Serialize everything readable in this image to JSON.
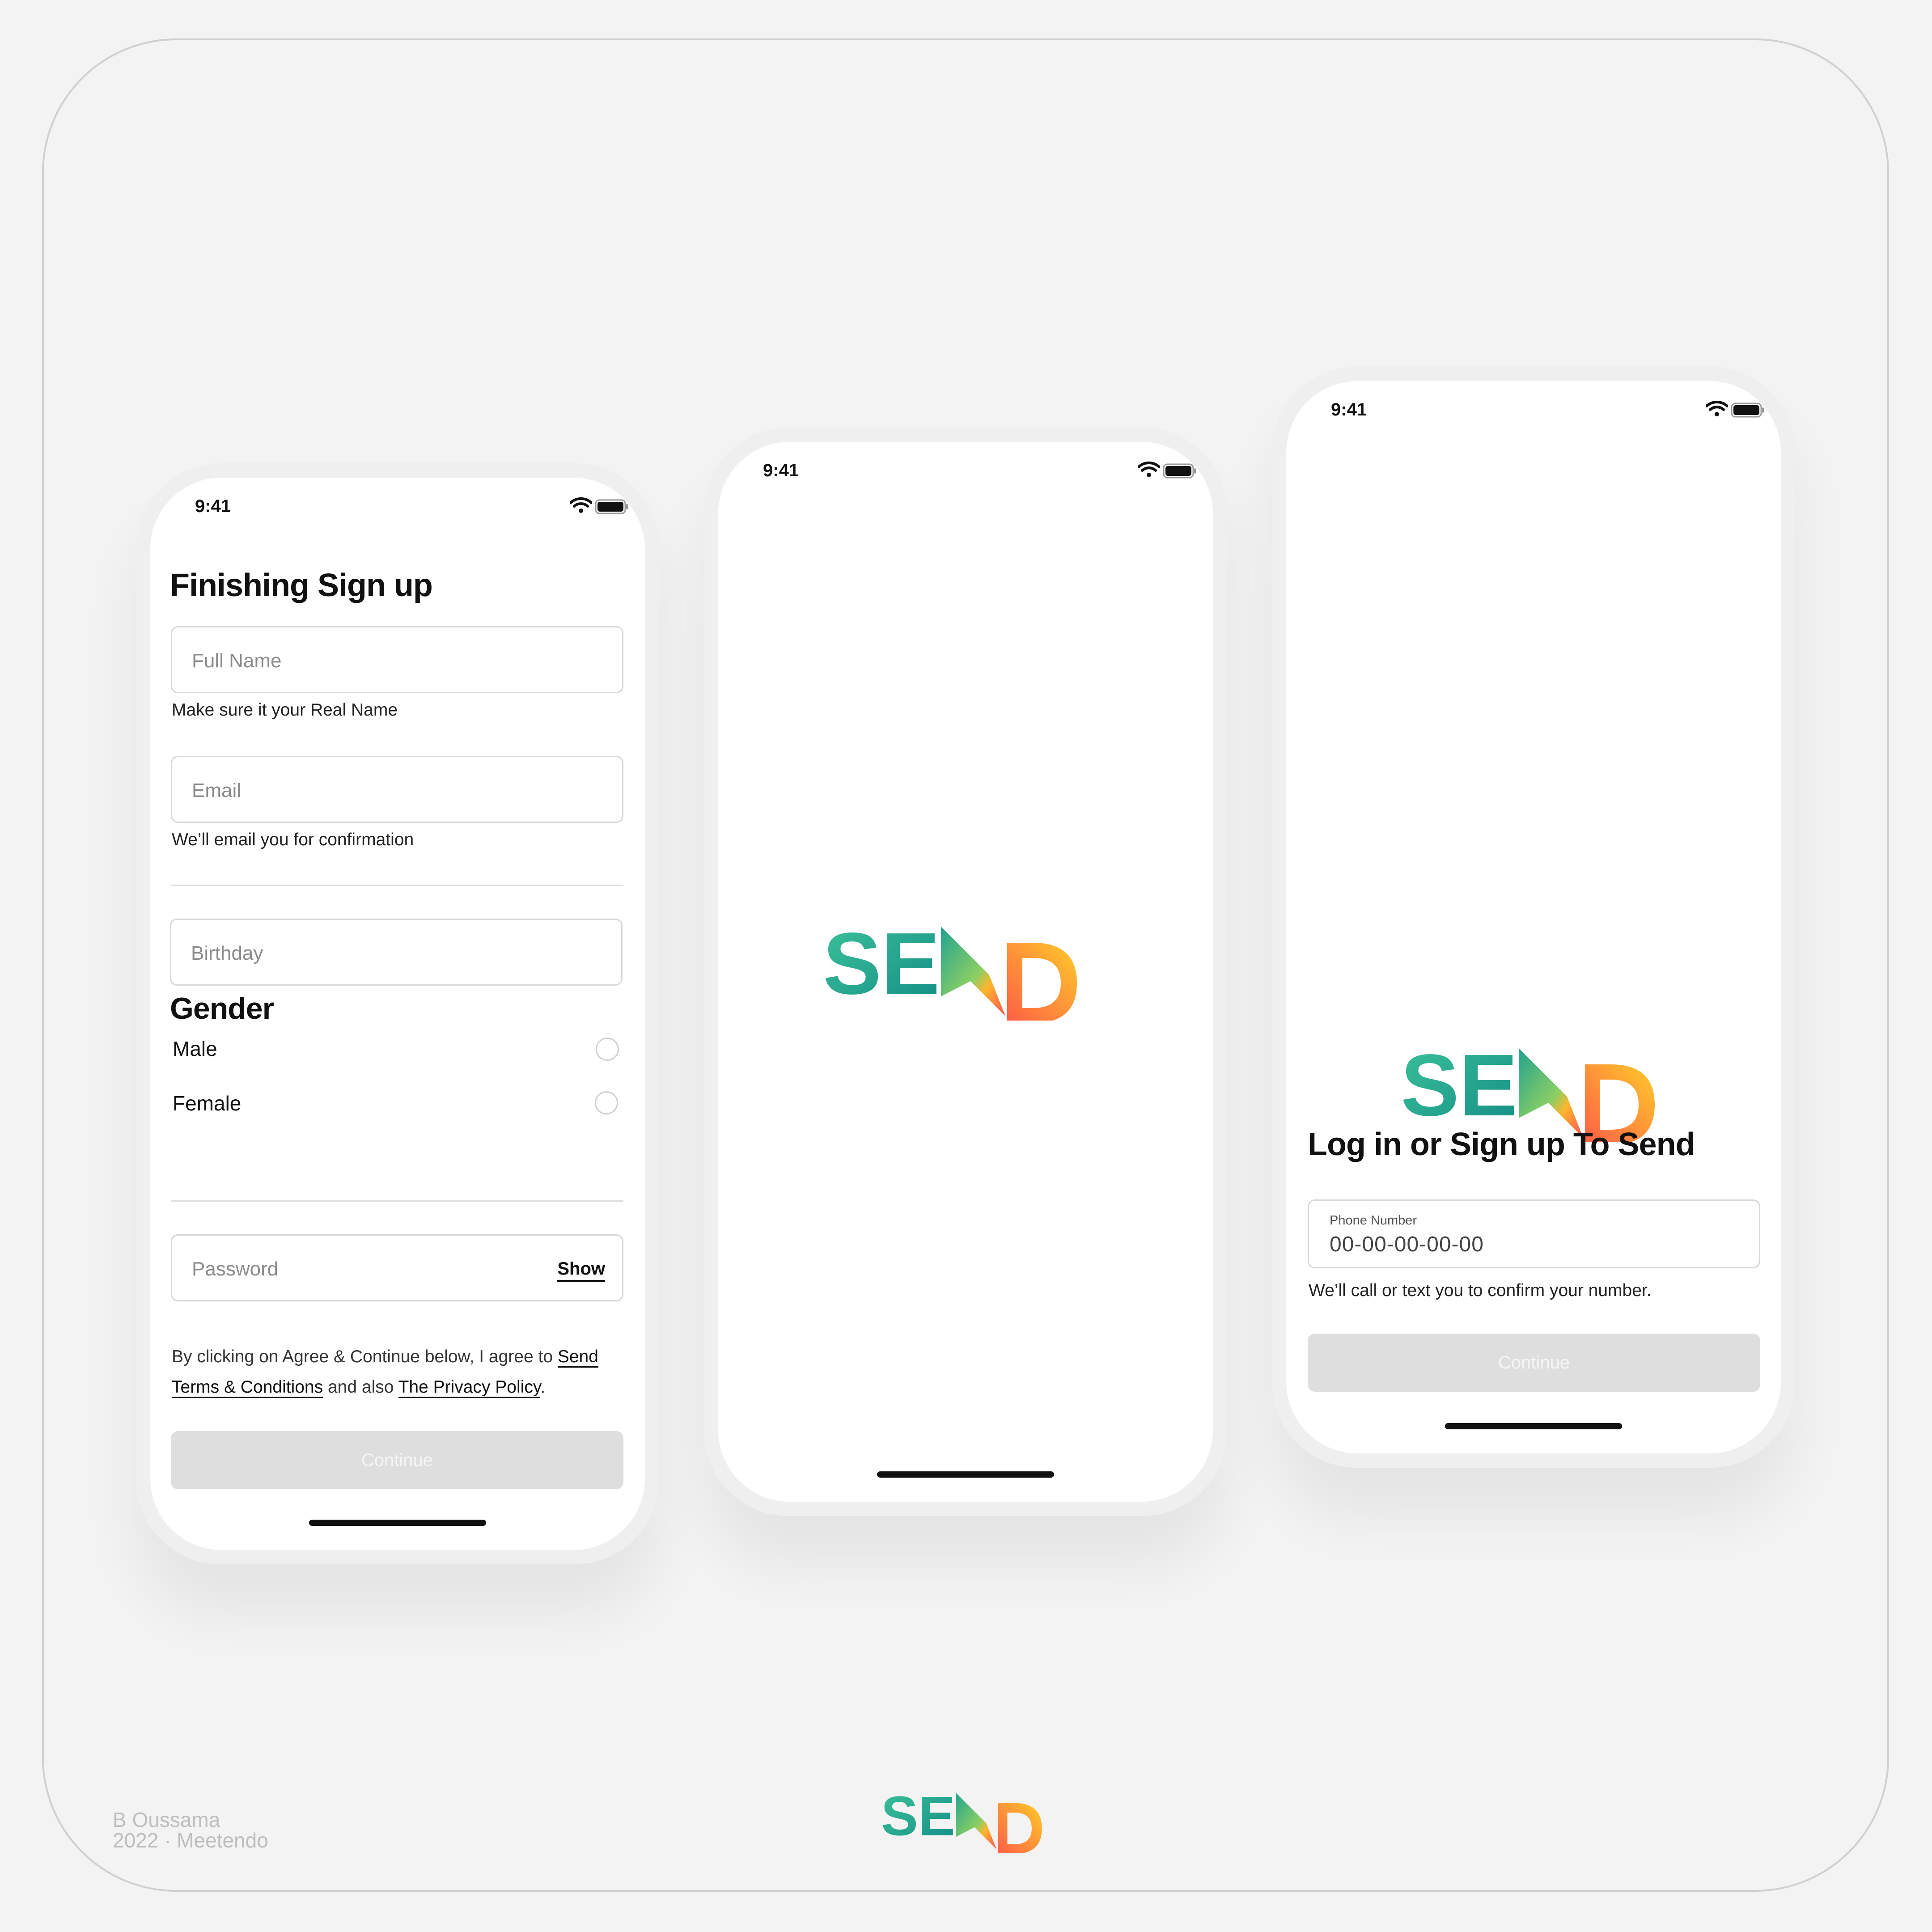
{
  "status_bar": {
    "time": "9:41"
  },
  "brand": {
    "logo_text": "SEND",
    "colors": {
      "teal": "#1a9c8c",
      "teal_light": "#3cc29a",
      "orange": "#ff6a3d",
      "yellow": "#ffc928"
    }
  },
  "signup_screen": {
    "title": "Finishing Sign up",
    "full_name": {
      "placeholder": "Full Name",
      "hint": "Make sure it your Real Name"
    },
    "email": {
      "placeholder": "Email",
      "hint": "We’ll email you for confirmation"
    },
    "birthday": {
      "placeholder": "Birthday"
    },
    "gender": {
      "title": "Gender",
      "options": [
        {
          "label": "Male",
          "selected": false
        },
        {
          "label": "Female",
          "selected": false
        }
      ]
    },
    "password": {
      "placeholder": "Password",
      "toggle_label": "Show"
    },
    "terms": {
      "prefix": "By clicking on Agree & Continue below, I agree to ",
      "link_send": "Send",
      "link_terms": "Terms & Conditions",
      "middle": " and also ",
      "link_privacy": "The Privacy Policy",
      "suffix": "."
    },
    "continue_label": "Continue"
  },
  "login_screen": {
    "title": "Log in or Sign up To Send",
    "phone": {
      "label": "Phone Number",
      "value": "00-00-00-00-00"
    },
    "hint": "We’ll call or text you to confirm your number.",
    "continue_label": "Continue"
  },
  "footer": {
    "author": "B Oussama",
    "year_company": "2022 · Meetendo"
  }
}
